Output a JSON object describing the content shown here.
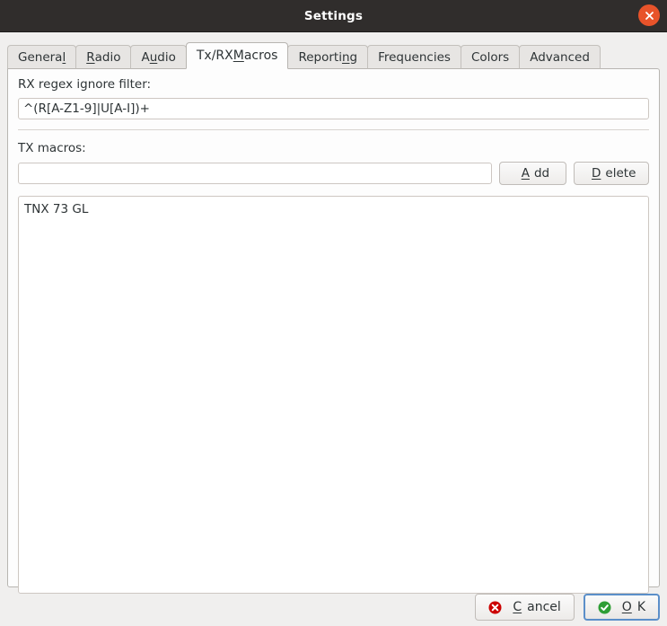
{
  "window": {
    "title": "Settings",
    "close_icon": "close-icon",
    "close_glyph": "✕",
    "titlebar_color": "#302d2c",
    "close_button_color": "#e8532a"
  },
  "tabs": [
    {
      "id": "general",
      "label_before": "Genera",
      "mnemonic": "l",
      "label_after": "",
      "active": false
    },
    {
      "id": "radio",
      "label_before": "",
      "mnemonic": "R",
      "label_after": "adio",
      "active": false
    },
    {
      "id": "audio",
      "label_before": "A",
      "mnemonic": "u",
      "label_after": "dio",
      "active": false
    },
    {
      "id": "txrx-macros",
      "label_before": "Tx/RX ",
      "mnemonic": "M",
      "label_after": "acros",
      "active": true
    },
    {
      "id": "reporting",
      "label_before": "Reporti",
      "mnemonic": "n",
      "label_after": "g",
      "active": false
    },
    {
      "id": "frequencies",
      "label_before": "Frequencies",
      "mnemonic": "",
      "label_after": "",
      "active": false
    },
    {
      "id": "colors",
      "label_before": "Colors",
      "mnemonic": "",
      "label_after": "",
      "active": false
    },
    {
      "id": "advanced",
      "label_before": "Advanced",
      "mnemonic": "",
      "label_after": "",
      "active": false
    }
  ],
  "panel": {
    "rx_filter": {
      "label": "RX regex ignore filter:",
      "value": "^(R[A-Z1-9]|U[A-I])+",
      "placeholder": ""
    },
    "tx_macros": {
      "label": "TX macros:",
      "input_value": "",
      "input_placeholder": "",
      "add_button": {
        "before": "",
        "mnemonic": "A",
        "after": "dd"
      },
      "delete_button": {
        "before": "",
        "mnemonic": "D",
        "after": "elete"
      },
      "items": [
        "TNX 73 GL"
      ]
    }
  },
  "actions": {
    "cancel": {
      "before": "",
      "mnemonic": "C",
      "after": "ancel",
      "icon": "cancel-icon",
      "icon_color": "#cc0000"
    },
    "ok": {
      "before": "",
      "mnemonic": "O",
      "after": "K",
      "icon": "ok-check-icon",
      "icon_color": "#2e9e35"
    }
  }
}
